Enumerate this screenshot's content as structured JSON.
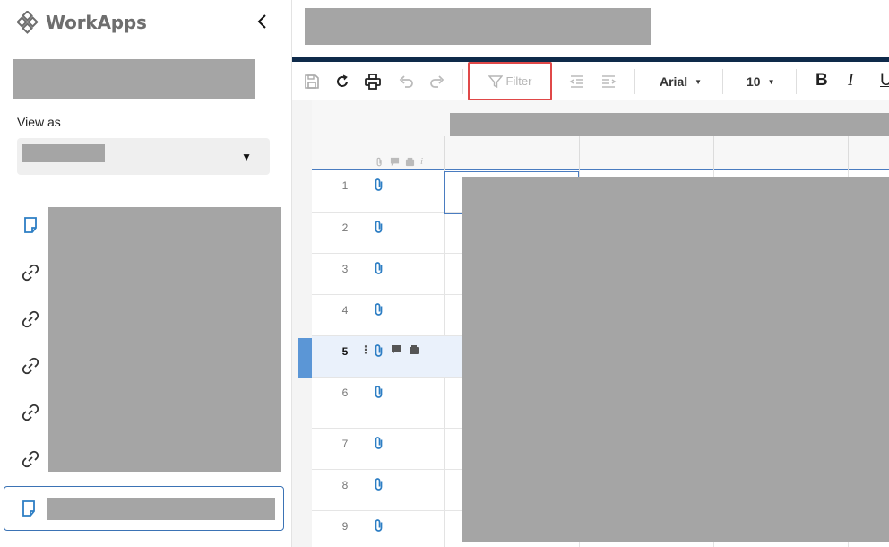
{
  "app": {
    "logo_text": "WorkApps",
    "accent_color": "#0e2a4a",
    "link_color": "#3b73b5",
    "filter_highlight_color": "#e04848"
  },
  "sidebar": {
    "view_as_label": "View as",
    "nav_icons": [
      "form-icon",
      "link-icon",
      "link-icon",
      "link-icon",
      "link-icon",
      "link-icon",
      "form-icon"
    ]
  },
  "toolbar": {
    "filter_label": "Filter",
    "font_family": "Arial",
    "font_size": "10",
    "bold_label": "B",
    "italic_label": "I",
    "underline_label": "U"
  },
  "grid": {
    "rows": [
      {
        "num": "1"
      },
      {
        "num": "2"
      },
      {
        "num": "3"
      },
      {
        "num": "4"
      },
      {
        "num": "5"
      },
      {
        "num": "6"
      },
      {
        "num": "7"
      },
      {
        "num": "8"
      },
      {
        "num": "9"
      }
    ],
    "selected_row": "5"
  }
}
